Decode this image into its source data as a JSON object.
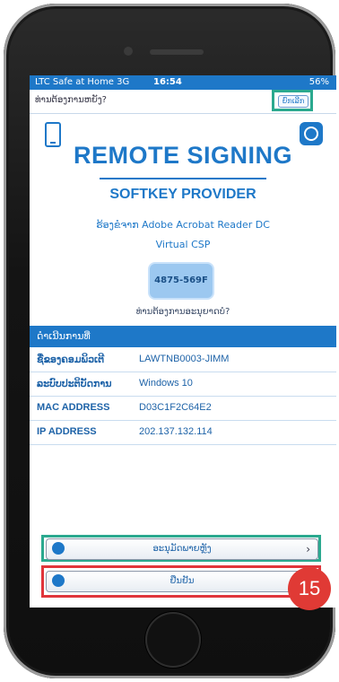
{
  "statusbar": {
    "carrier": "LTC Safe at Home  3G",
    "time": "16:54",
    "battery": "56%"
  },
  "topbar": {
    "question": "ທ່ານຕ້ອງການຫຍັງ?",
    "cancel_label": "ຍົກເລີກ"
  },
  "header": {
    "title": "REMOTE SIGNING",
    "subtitle": "SOFTKEY PROVIDER"
  },
  "request": {
    "from_label": "ຮ້ອງຂໍຈາກ Adobe Acrobat Reader DC",
    "csp": "Virtual CSP",
    "code": "4875-569F",
    "prompt": "ທ່ານຕ້ອງການອະນຸຍາດບໍ?"
  },
  "info": {
    "section_title": "ດຳເນີນການທີ່",
    "rows": [
      {
        "key": "ຊື່ຂອງຄອມພິວເຕີ",
        "value": "LAWTNB0003-JIMM"
      },
      {
        "key": "ລະບົບປະຕິບັດການ",
        "value": "Windows 10"
      },
      {
        "key": "MAC ADDRESS",
        "value": "D03C1F2C64E2"
      },
      {
        "key": "IP ADDRESS",
        "value": "202.137.132.114"
      }
    ]
  },
  "buttons": {
    "allow_label": "ອະນຸມັດພາຍຫຼັງ",
    "confirm_label": "ຢືນຢັນ"
  },
  "annotation": {
    "step": "15"
  }
}
